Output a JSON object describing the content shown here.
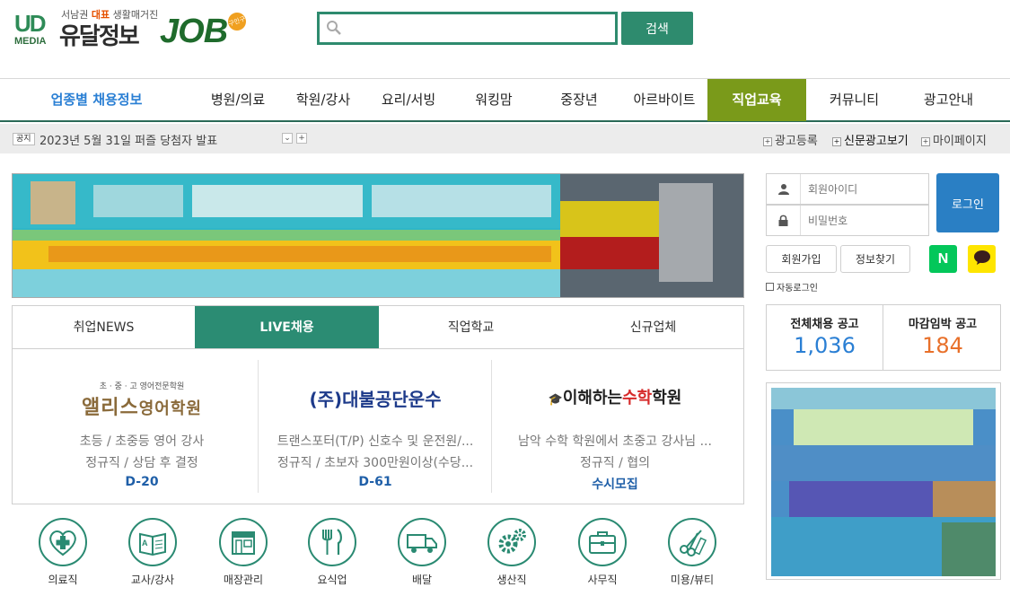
{
  "header": {
    "logo": {
      "mark": "UD",
      "mark_sub": "MEDIA",
      "tagline_pre": "서남권 ",
      "tagline_bold": "대표",
      "tagline_post": " 생활매거진",
      "brand": "유달정보",
      "job": "JOB",
      "badge": "구인구직"
    },
    "search": {
      "placeholder": "",
      "button": "검색"
    }
  },
  "nav": {
    "category": "업종별 채용정보",
    "items": [
      "병원/의료",
      "학원/강사",
      "요리/서빙",
      "워킹맘",
      "중장년",
      "아르바이트",
      "직업교육",
      "커뮤니티",
      "광고안내"
    ],
    "active": "직업교육"
  },
  "notice": {
    "tag": "공지",
    "text": "2023년 5월 31일 퍼즐 당첨자 발표",
    "links": [
      "광고등록",
      "신문광고보기",
      "마이페이지"
    ]
  },
  "tabs": [
    "취업NEWS",
    "LIVE채용",
    "직업학교",
    "신규업체"
  ],
  "active_tab": "LIVE채용",
  "jobs": [
    {
      "logo_top": "초 · 중 · 고 영어전문학원",
      "logo_main": "앨리스",
      "logo_sub": "영어학원",
      "line1": "초등 / 초중등 영어 강사",
      "line2": "정규직 / 상담 후 결정",
      "deadline": "D-20"
    },
    {
      "logo_main": "(주)대불공단운수",
      "line1": "트랜스포터(T/P) 신호수 및 운전원/...",
      "line2": "정규직 / 초보자 300만원이상(수당...",
      "deadline": "D-61"
    },
    {
      "logo_pre": "이해하는",
      "logo_accent": "수학",
      "logo_post": "학원",
      "line1": "남악 수학 학원에서 초중고 강사님 ...",
      "line2": "정규직 / 협의",
      "deadline": "수시모집"
    }
  ],
  "categories": [
    {
      "label": "의료직",
      "icon": "medical-cross-icon"
    },
    {
      "label": "교사/강사",
      "icon": "book-icon"
    },
    {
      "label": "매장관리",
      "icon": "storefront-icon"
    },
    {
      "label": "요식업",
      "icon": "fork-knife-icon"
    },
    {
      "label": "배달",
      "icon": "delivery-truck-icon"
    },
    {
      "label": "생산직",
      "icon": "gears-icon"
    },
    {
      "label": "사무직",
      "icon": "briefcase-icon"
    },
    {
      "label": "미용/뷰티",
      "icon": "scissors-comb-icon"
    }
  ],
  "login": {
    "id_placeholder": "회원아이디",
    "pw_placeholder": "비밀번호",
    "button": "로그인",
    "signup": "회원가입",
    "find": "정보찾기",
    "naver": "N",
    "auto": "자동로그인"
  },
  "stats": [
    {
      "label": "전체채용 공고",
      "value": "1,036",
      "color": "#2a7fd4"
    },
    {
      "label": "마감임박 공고",
      "value": "184",
      "color": "#e8702a"
    }
  ],
  "colors": {
    "brand_green": "#2b8c73",
    "nav_active": "#7a9a1a",
    "login_blue": "#2a7fc4"
  }
}
